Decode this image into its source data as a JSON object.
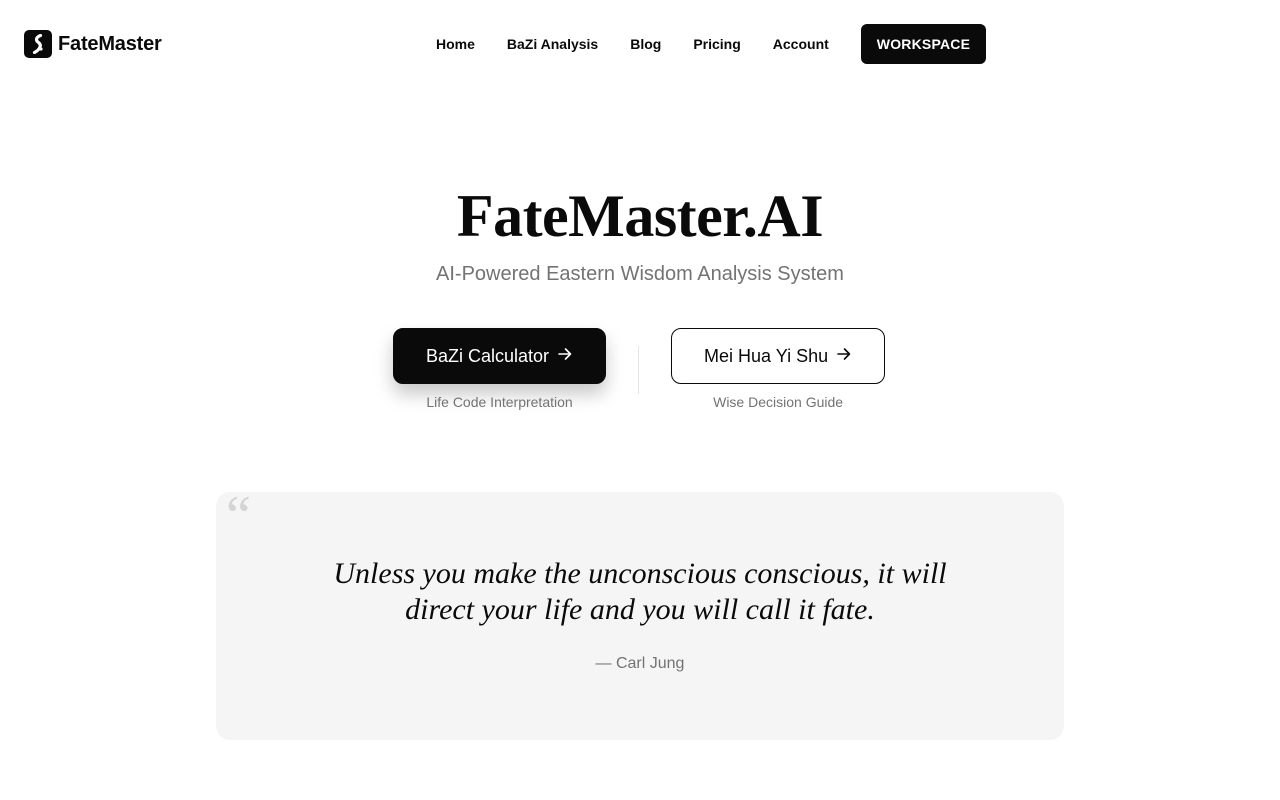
{
  "brand": {
    "name": "FateMaster",
    "logo_icon": "yin-yang-swirl-icon"
  },
  "nav": {
    "links": [
      "Home",
      "BaZi Analysis",
      "Blog",
      "Pricing",
      "Account"
    ],
    "workspace_label": "WORKSPACE"
  },
  "hero": {
    "title": "FateMaster.AI",
    "subtitle": "AI-Powered Eastern Wisdom Analysis System"
  },
  "cta": {
    "primary": {
      "label": "BaZi Calculator",
      "caption": "Life Code Interpretation",
      "icon": "arrow-right-icon"
    },
    "secondary": {
      "label": "Mei Hua Yi Shu",
      "caption": "Wise Decision Guide",
      "icon": "arrow-right-icon"
    }
  },
  "quote": {
    "mark": "“",
    "text": "Unless you make the unconscious conscious, it will direct your life and you will call it fate.",
    "author": "— Carl Jung"
  },
  "colors": {
    "primary": "#0a0a0a",
    "muted": "#737373",
    "card_bg": "#f5f5f5"
  }
}
